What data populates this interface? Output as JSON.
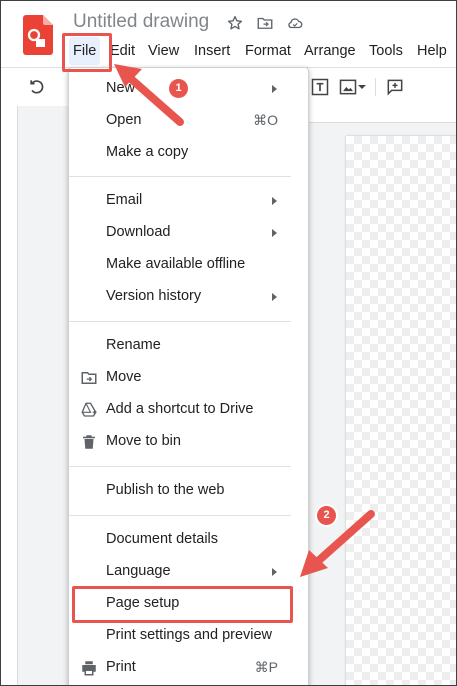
{
  "document": {
    "title": "Untitled drawing"
  },
  "menubar": {
    "items": [
      {
        "label": "File"
      },
      {
        "label": "Edit"
      },
      {
        "label": "View"
      },
      {
        "label": "Insert"
      },
      {
        "label": "Format"
      },
      {
        "label": "Arrange"
      },
      {
        "label": "Tools"
      },
      {
        "label": "Help"
      }
    ],
    "active": "File"
  },
  "file_menu": {
    "items": [
      {
        "label": "New",
        "submenu": true
      },
      {
        "label": "Open",
        "shortcut": "⌘O"
      },
      {
        "label": "Make a copy"
      },
      {
        "label": "Email",
        "submenu": true
      },
      {
        "label": "Download",
        "submenu": true
      },
      {
        "label": "Make available offline"
      },
      {
        "label": "Version history",
        "submenu": true
      },
      {
        "label": "Rename"
      },
      {
        "label": "Move",
        "icon": "folder-move-icon"
      },
      {
        "label": "Add a shortcut to Drive",
        "icon": "drive-shortcut-icon"
      },
      {
        "label": "Move to bin",
        "icon": "trash-icon"
      },
      {
        "label": "Publish to the web"
      },
      {
        "label": "Document details"
      },
      {
        "label": "Language",
        "submenu": true
      },
      {
        "label": "Page setup",
        "highlighted": true
      },
      {
        "label": "Print settings and preview"
      },
      {
        "label": "Print",
        "shortcut": "⌘P",
        "icon": "print-icon"
      }
    ]
  },
  "annotations": {
    "step1": "1",
    "step2": "2",
    "color": "#e8554e"
  },
  "colors": {
    "brand_red": "#ea4335",
    "active_menu_bg": "#e8f0fe",
    "icon_grey": "#5f6368"
  }
}
